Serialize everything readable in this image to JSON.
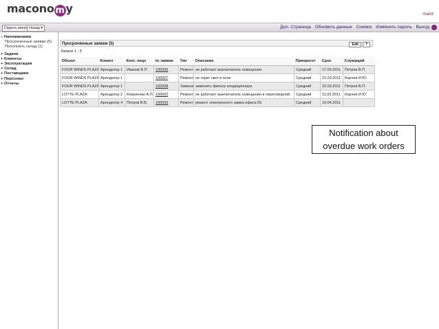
{
  "header": {
    "logo_pre": "macono",
    "logo_circle": "m",
    "logo_post": "y",
    "username": "maint"
  },
  "toolbar": {
    "hide_menu": "Скрыть меню",
    "back": "Назад ▾",
    "links": [
      "Доп. Страница",
      "Обновить данные",
      "Снимок",
      "Изменить пароль",
      "Выход"
    ]
  },
  "tree": {
    "reminders": "– Напоминания",
    "overdue": "Просроченные заявки (5)",
    "replenish": "Пополнить склад (1)",
    "tasks": "+ Задачи",
    "clients": "+ Клиенты",
    "operation": "+ Эксплуатация",
    "warehouse": "+ Склад",
    "suppliers": "+ Поставщики",
    "staff": "+ Персонал",
    "reports": "+ Отчеты"
  },
  "panel": {
    "title": "Просроченные заявки (5)",
    "btn_edit": "Edit",
    "btn_help": "?",
    "records": "Записи 1 - 5",
    "columns": [
      "Объект",
      "Клиент",
      "Конт. лицо",
      "№ заявки",
      "Тип",
      "Описание",
      "Приоритет",
      "Срок",
      "Служащий"
    ],
    "rows": [
      [
        "FOUR WINDS PLAZA",
        "Арендатор 1",
        "Иванов В.П.",
        "100006",
        "Ремонт",
        "не работает выключатель освещения",
        "Средний",
        "17.03.2011",
        "Петров В.П."
      ],
      [
        "FOUR WINDS PLAZA",
        "Арендатор 1",
        "",
        "100007",
        "Ремонт",
        "не горит свет в холе",
        "Средний",
        "21.03.2011",
        "Корнев И.Ю."
      ],
      [
        "FOUR WINDS PLAZA",
        "Арендатор 1",
        "",
        "100008",
        "Замена",
        "заменить фильтр кондиционера",
        "Средний",
        "22.03.2011",
        "Петров В.П."
      ],
      [
        "LOTTE PLAZA",
        "Арендатор 2",
        "Коваленко А.П.",
        "100002",
        "Ремонт",
        "не работает выключатель освещения в переговорной",
        "Средний",
        "11.03.2011",
        "Корнев И.Ю."
      ],
      [
        "LOTTE PLAZA",
        "Арендатор 4",
        "Петров В.В,",
        "100009",
        "Ремонт",
        "ремонт электронного замка офиса 55",
        "Средний",
        "10.04.2011",
        ""
      ]
    ]
  },
  "callout": {
    "line1": "Notification  about",
    "line2": "overdue work orders"
  }
}
